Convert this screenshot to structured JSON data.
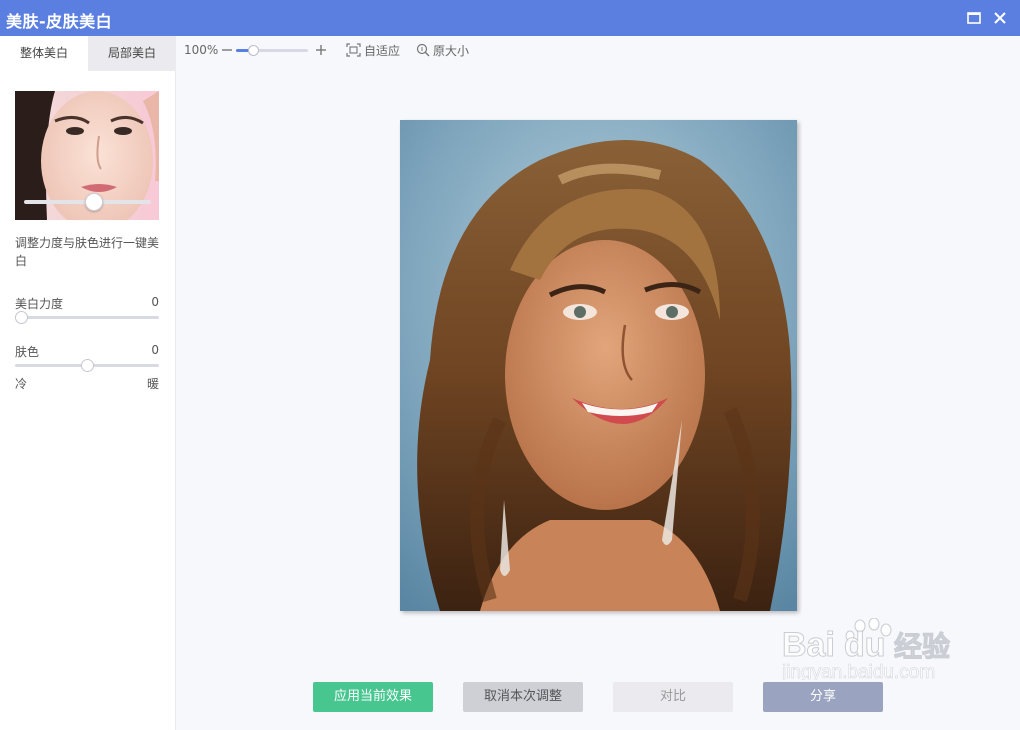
{
  "window": {
    "title": "美肤-皮肤美白",
    "maximize_icon": "maximize-icon",
    "close_icon": "close-icon",
    "titlebar_color": "#5a7fe0"
  },
  "tabs": [
    {
      "label": "整体美白",
      "active": true
    },
    {
      "label": "局部美白",
      "active": false
    }
  ],
  "panel": {
    "preview_slider_value": 0.55,
    "description": "调整力度与肤色进行一键美白",
    "whitening": {
      "label": "美白力度",
      "value": "0",
      "position": 0
    },
    "skin_tone": {
      "label": "肤色",
      "value": "0",
      "position": 0.5,
      "min_label": "冷",
      "max_label": "暖"
    }
  },
  "toolbar": {
    "zoom_label": "100%",
    "zoom_level": 0.2,
    "fit_label": "自适应",
    "original_size_label": "原大小"
  },
  "actions": {
    "apply_label": "应用当前效果",
    "cancel_label": "取消本次调整",
    "compare_label": "对比",
    "share_label": "分享"
  },
  "watermark": {
    "brand": "Baidu经验",
    "url": "jingyan.baidu.com"
  },
  "colors": {
    "accent": "#5a7fe0",
    "apply": "#47c690"
  }
}
